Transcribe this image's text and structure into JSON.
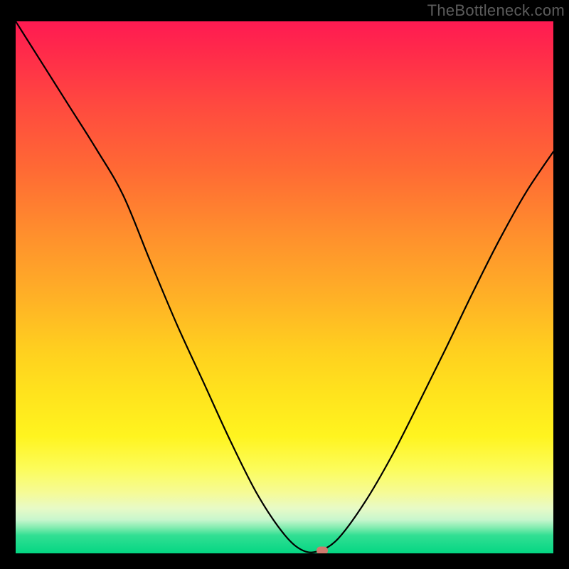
{
  "watermark_text": "TheBottleneck.com",
  "chart_data": {
    "type": "line",
    "title": "",
    "xlabel": "",
    "ylabel": "",
    "x": [
      0.0,
      0.05,
      0.1,
      0.15,
      0.2,
      0.25,
      0.3,
      0.35,
      0.4,
      0.45,
      0.5,
      0.535,
      0.565,
      0.6,
      0.65,
      0.7,
      0.75,
      0.8,
      0.85,
      0.9,
      0.95,
      1.0
    ],
    "y": [
      1.0,
      0.92,
      0.84,
      0.76,
      0.673,
      0.55,
      0.43,
      0.32,
      0.21,
      0.11,
      0.035,
      0.005,
      0.005,
      0.028,
      0.097,
      0.184,
      0.283,
      0.385,
      0.49,
      0.59,
      0.68,
      0.755
    ],
    "xlim": [
      0,
      1
    ],
    "ylim": [
      0,
      1
    ],
    "marker": {
      "x": 0.57,
      "y": 0.005
    },
    "background_gradient": {
      "orientation": "vertical",
      "stops": [
        {
          "pos": 0.0,
          "color": "#ff1a52"
        },
        {
          "pos": 0.4,
          "color": "#ff8f2d"
        },
        {
          "pos": 0.7,
          "color": "#ffe31d"
        },
        {
          "pos": 0.88,
          "color": "#f6fb95"
        },
        {
          "pos": 1.0,
          "color": "#04d683"
        }
      ]
    }
  }
}
